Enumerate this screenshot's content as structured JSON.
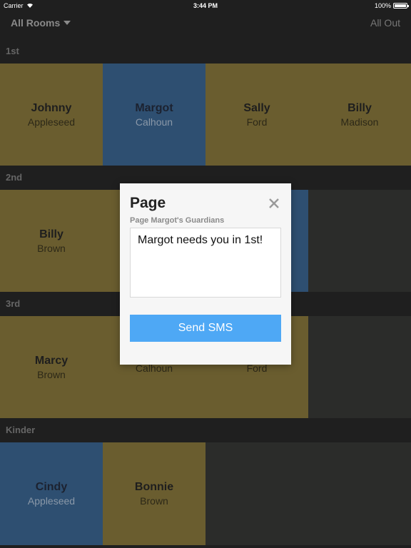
{
  "status_bar": {
    "carrier": "Carrier",
    "time": "3:44 PM",
    "battery": "100%",
    "battery_level": 1.0
  },
  "header": {
    "room_selector": "All Rooms",
    "all_out": "All Out"
  },
  "sections": [
    {
      "name": "1st",
      "children": [
        {
          "first": "Johnny",
          "last": "Appleseed",
          "color": "gold"
        },
        {
          "first": "Margot",
          "last": "Calhoun",
          "color": "blue"
        },
        {
          "first": "Sally",
          "last": "Ford",
          "color": "gold"
        },
        {
          "first": "Billy",
          "last": "Madison",
          "color": "gold"
        }
      ]
    },
    {
      "name": "2nd",
      "children": [
        {
          "first": "Billy",
          "last": "Brown",
          "color": "gold"
        },
        {
          "first": "",
          "last": "",
          "color": "gold"
        },
        {
          "first": "",
          "last": "",
          "color": "blue"
        },
        {
          "first": "",
          "last": "",
          "color": "empty"
        }
      ]
    },
    {
      "name": "3rd",
      "children": [
        {
          "first": "Marcy",
          "last": "Brown",
          "color": "gold"
        },
        {
          "first": "",
          "last": "Calhoun",
          "color": "gold"
        },
        {
          "first": "",
          "last": "Ford",
          "color": "gold"
        },
        {
          "first": "",
          "last": "",
          "color": "empty"
        }
      ]
    },
    {
      "name": "Kinder",
      "children": [
        {
          "first": "Cindy",
          "last": "Appleseed",
          "color": "blue"
        },
        {
          "first": "Bonnie",
          "last": "Brown",
          "color": "gold"
        },
        {
          "first": "",
          "last": "",
          "color": "empty"
        },
        {
          "first": "",
          "last": "",
          "color": "empty"
        }
      ]
    }
  ],
  "modal": {
    "title": "Page",
    "subtitle": "Page Margot's Guardians",
    "message": "Margot needs you in 1st!",
    "send_label": "Send SMS"
  },
  "colors": {
    "gold": "#6a5d2f",
    "blue": "#2e4f71",
    "accent": "#4ea8f5",
    "background": "#1f1f1f"
  }
}
